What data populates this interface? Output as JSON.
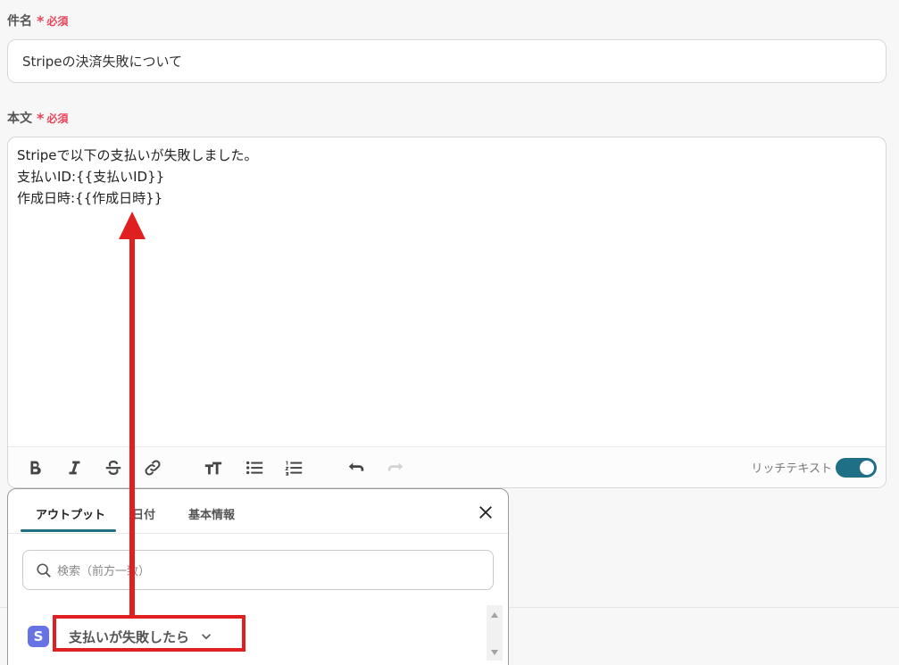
{
  "subject": {
    "label": "件名",
    "required_mark": "*",
    "required_text": "必須",
    "value": "Stripeの決済失敗について"
  },
  "body": {
    "label": "本文",
    "required_mark": "*",
    "required_text": "必須",
    "lines": [
      "Stripeで以下の支払いが失敗しました。",
      "支払いID:{{支払いID}}",
      "作成日時:{{作成日時}}"
    ]
  },
  "toolbar": {
    "rich_text_label": "リッチテキスト",
    "rich_text_enabled": true,
    "icons": [
      "bold-icon",
      "italic-icon",
      "strikethrough-icon",
      "link-icon",
      "text-size-icon",
      "bullet-list-icon",
      "numbered-list-icon",
      "undo-icon",
      "redo-icon"
    ]
  },
  "panel": {
    "tabs": [
      {
        "label": "アウトプット",
        "active": true
      },
      {
        "label": "日付",
        "active": false
      },
      {
        "label": "基本情報",
        "active": false
      }
    ],
    "search_placeholder": "検索（前方一致）",
    "app_icon_letter": "S",
    "trigger_label": "支払いが失敗したら"
  },
  "colors": {
    "accent": "#1f6f86",
    "required": "#e8455b",
    "annotation": "#e02020",
    "stripe": "#6772e5"
  }
}
